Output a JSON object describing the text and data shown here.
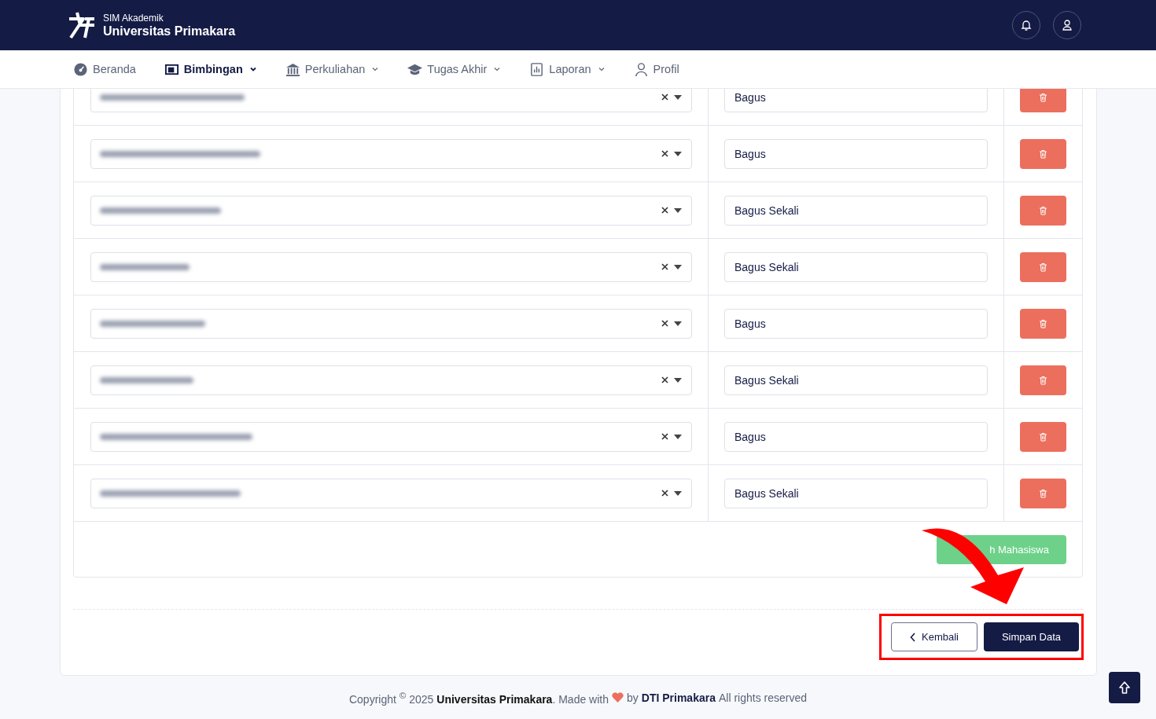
{
  "header": {
    "app_name": "SIM Akademik",
    "university": "Universitas Primakara"
  },
  "nav": [
    {
      "label": "Beranda",
      "selected": false,
      "dropdown": false
    },
    {
      "label": "Bimbingan",
      "selected": true,
      "dropdown": true
    },
    {
      "label": "Perkuliahan",
      "selected": false,
      "dropdown": true
    },
    {
      "label": "Tugas Akhir",
      "selected": false,
      "dropdown": true
    },
    {
      "label": "Laporan",
      "selected": false,
      "dropdown": true
    },
    {
      "label": "Profil",
      "selected": false,
      "dropdown": false
    }
  ],
  "rows": [
    {
      "rating": "Bagus"
    },
    {
      "rating": "Bagus"
    },
    {
      "rating": "Bagus Sekali"
    },
    {
      "rating": "Bagus Sekali"
    },
    {
      "rating": "Bagus"
    },
    {
      "rating": "Bagus Sekali"
    },
    {
      "rating": "Bagus"
    },
    {
      "rating": "Bagus Sekali"
    }
  ],
  "add_button": "h Mahasiswa",
  "back_button": "Kembali",
  "save_button": "Simpan Data",
  "footer": {
    "text": "Copyright $^{©}$ 2025 **Universitas Primakara**. Made with",
    "by": "by",
    "link": "DTI Primakara",
    "rest": "All rights reserved"
  }
}
